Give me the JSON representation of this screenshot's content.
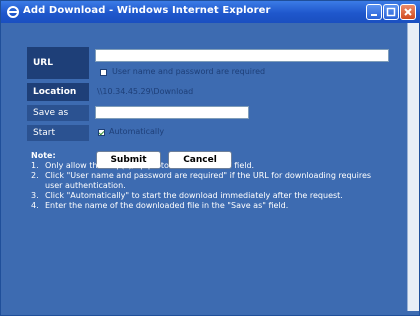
{
  "window": {
    "title": "Add Download - Windows Internet Explorer"
  },
  "form": {
    "url_label": "URL",
    "url_value": "",
    "auth_checkbox_label": "User name and password are required",
    "auth_checked": false,
    "location_label": "Location",
    "location_value": "\\\\10.34.45.29\\Download",
    "save_as_label": "Save as",
    "save_as_value": "",
    "start_label": "Start",
    "auto_label": "Automatically",
    "auto_checked": true,
    "submit_label": "Submit",
    "cancel_label": "Cancel"
  },
  "notes": {
    "title": "Note:",
    "items": [
      {
        "num": "1.",
        "text": "Only allow the http(s)/ftp protocol in the \"URL\" field."
      },
      {
        "num": "2.",
        "text": "Click \"User name and password are required\" if the URL for downloading requires user authentication."
      },
      {
        "num": "3.",
        "text": "Click \"Automatically\" to start the download immediately after the request."
      },
      {
        "num": "4.",
        "text": "Enter the name of the downloaded file in the \"Save as\" field."
      }
    ]
  },
  "colors": {
    "titlebar": "#1f57cc",
    "background": "#3d6bb1",
    "label_dark": "#1e3f78"
  }
}
